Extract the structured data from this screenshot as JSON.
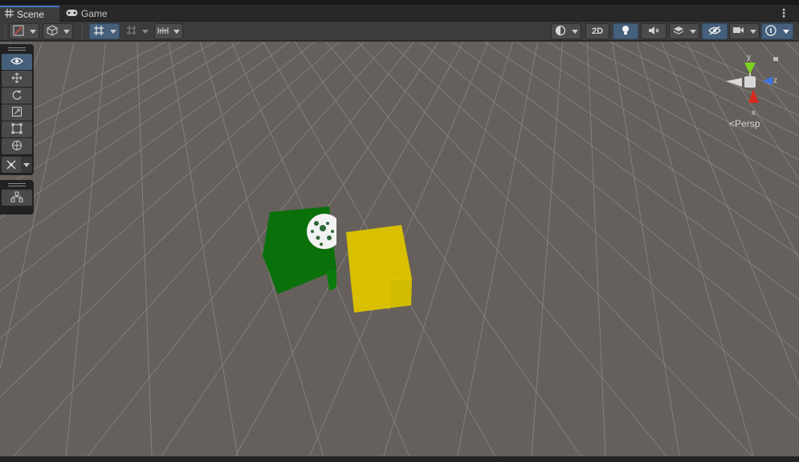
{
  "tabs": [
    {
      "label": "Scene",
      "icon": "hash-grid-icon",
      "active": true
    },
    {
      "label": "Game",
      "icon": "gamepad-icon",
      "active": false
    }
  ],
  "toolbar": {
    "toggle_2d": "2D"
  },
  "gizmo": {
    "axis_y": "y",
    "axis_z": "z",
    "axis_x": "x",
    "projection": "Persp"
  },
  "scene": {
    "objects": [
      {
        "name": "green-cube",
        "color": "#0b730b"
      },
      {
        "name": "textured-sphere",
        "color": "#f2f2f2"
      },
      {
        "name": "yellow-cube",
        "color": "#d8c000"
      }
    ],
    "background": "#65605b",
    "grid_color": "#8a8581"
  },
  "colors": {
    "accent": "#3a79bb",
    "toggle_on": "#46607c",
    "axis_x": "#d42a1e",
    "axis_y": "#7ed321",
    "axis_z": "#3b74e0"
  }
}
